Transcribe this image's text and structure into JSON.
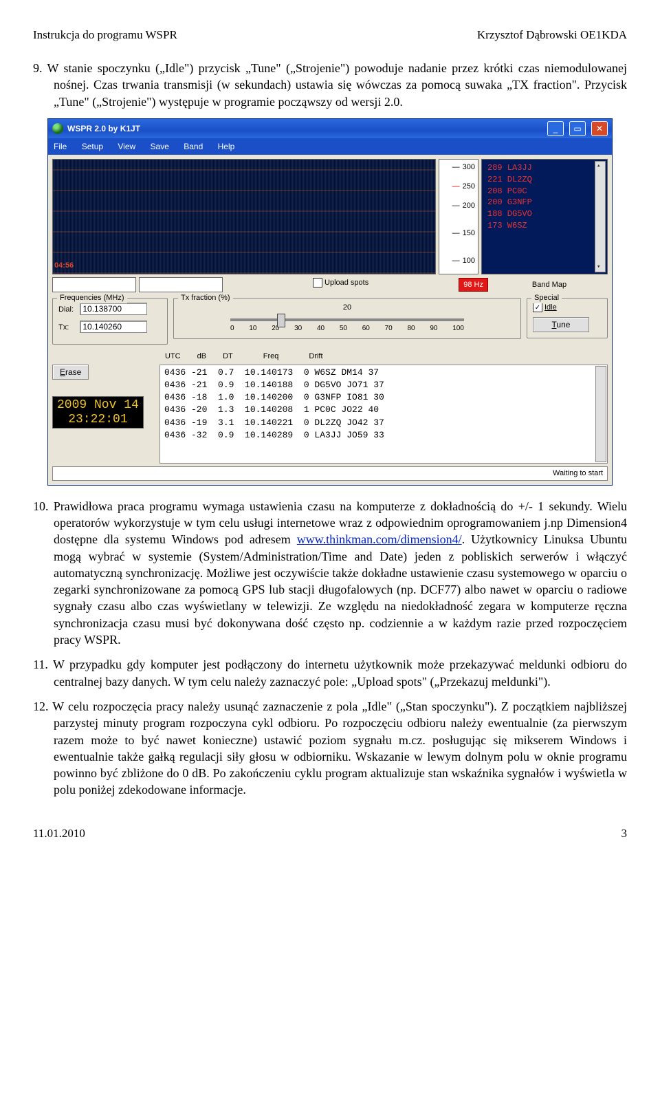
{
  "doc": {
    "header_left": "Instrukcja do programu WSPR",
    "header_right": "Krzysztof Dąbrowski OE1KDA",
    "item9_text": "9.  W stanie spoczynku („Idle\") przycisk „Tune\" („Strojenie\") powoduje nadanie przez krótki czas niemodulowanej nośnej. Czas trwania transmisji (w sekundach) ustawia się wówczas za pomocą suwaka „TX fraction\". Przycisk „Tune\" („Strojenie\") występuje w programie począwszy od wersji 2.0.",
    "item10_a": "10. Prawidłowa praca programu wymaga ustawienia czasu na komputerze z dokładnością do +/- 1 sekundy. Wielu operatorów wykorzystuje w tym celu usługi internetowe wraz z odpowiednim oprogramowaniem j.np Dimension4 dostępne dla systemu Windows pod adresem ",
    "item10_link": "www.thinkman.com/dimension4/",
    "item10_b": ". Użytkownicy Linuksa Ubuntu mogą wybrać w systemie (System/Administration/Time and Date) jeden z pobliskich serwerów i włączyć automatyczną synchronizację. Możliwe jest oczywiście także dokładne ustawienie czasu systemowego w oparciu o zegarki synchronizowane za pomocą GPS lub stacji długofalowych (np. DCF77) albo nawet w oparciu o radiowe sygnały czasu albo czas wyświetlany w telewizji. Ze względu na niedokładność zegara w komputerze ręczna synchronizacja czasu musi być dokonywana dość często np. codziennie a w każdym razie przed rozpoczęciem pracy WSPR.",
    "item11_text": "11. W przypadku gdy komputer jest podłączony do internetu użytkownik może przekazywać meldunki odbioru do centralnej bazy danych. W tym celu należy zaznaczyć pole: „Upload spots\" („Przekazuj meldunki\").",
    "item12_text": "12. W celu rozpoczęcia pracy należy usunąć zaznaczenie z pola „Idle\" („Stan spoczynku\"). Z początkiem najbliższej parzystej minuty program rozpoczyna cykl odbioru. Po rozpoczęciu odbioru należy ewentualnie (za pierwszym razem może to być nawet konieczne) ustawić poziom sygnału m.cz. posługując się mikserem Windows i ewentualnie także gałką regulacji siły głosu w odbiorniku. Wskazanie w lewym dolnym polu w oknie programu powinno być zbliżone do 0 dB. Po zakończeniu cyklu program aktualizuje stan wskaźnika sygnałów i wyświetla w polu poniżej zdekodowane informacje.",
    "footer_left": "11.01.2010",
    "footer_right": "3"
  },
  "app": {
    "title": "WSPR 2.0      by K1JT",
    "menu": [
      "File",
      "Setup",
      "View",
      "Save",
      "Band",
      "Help"
    ],
    "waterfall_badge": "04:56",
    "scale_ticks": [
      "300",
      "250",
      "200",
      "150",
      "100"
    ],
    "decodes": [
      "289 LA3JJ",
      "221 DL2ZQ",
      "208 PC0C",
      "200 G3NFP",
      "188 DG5VO",
      "173 W6SZ"
    ],
    "upload_label": "Upload spots",
    "freq_badge": "98 Hz",
    "bandmap_label": "Band Map",
    "freq_group": "Frequencies (MHz)",
    "dial_label": "Dial:",
    "dial_value": "10.138700",
    "tx_label": "Tx:",
    "tx_value": "10.140260",
    "txfrac_group": "Tx fraction (%)",
    "txfrac_value": "20",
    "txfrac_ticks": [
      "0",
      "10",
      "20",
      "30",
      "40",
      "50",
      "60",
      "70",
      "80",
      "90",
      "100"
    ],
    "special_group": "Special",
    "idle_label": "Idle",
    "tune_label": "Tune",
    "erase_label": "Erase",
    "date_line1": "2009 Nov 14",
    "date_line2": "23:22:01",
    "data_headers": [
      "UTC",
      "dB",
      "DT",
      "Freq",
      "Drift"
    ],
    "data_rows": [
      "0436 -21  0.7  10.140173  0 W6SZ DM14 37",
      "0436 -21  0.9  10.140188  0 DG5VO JO71 37",
      "0436 -18  1.0  10.140200  0 G3NFP IO81 30",
      "0436 -20  1.3  10.140208  1 PC0C JO22 40",
      "0436 -19  3.1  10.140221  0 DL2ZQ JO42 37",
      "0436 -32  0.9  10.140289  0 LA3JJ JO59 33"
    ],
    "status": "Waiting to start"
  }
}
